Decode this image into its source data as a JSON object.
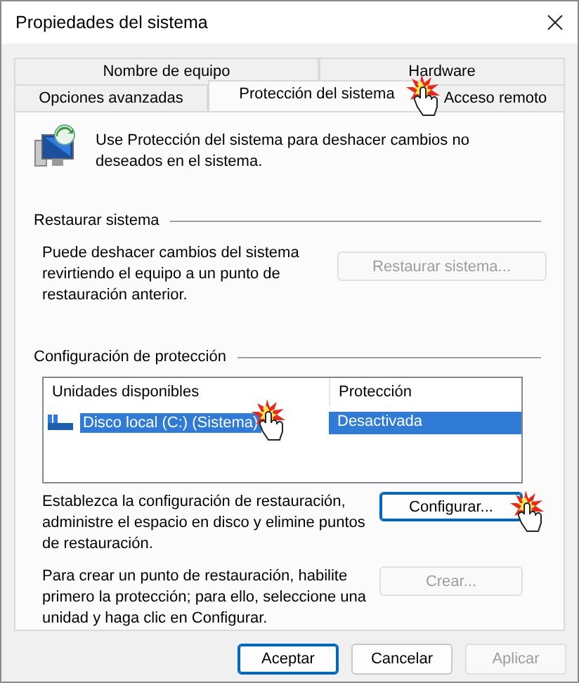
{
  "window": {
    "title": "Propiedades del sistema"
  },
  "tab_rows": [
    {
      "tabs": [
        {
          "label": "Nombre de equipo",
          "selected": false
        },
        {
          "label": "Hardware",
          "selected": false
        }
      ]
    },
    {
      "tabs": [
        {
          "label": "Opciones avanzadas",
          "selected": false
        },
        {
          "label": "Protección del sistema",
          "selected": true
        },
        {
          "label": "Acceso remoto",
          "selected": false
        }
      ]
    }
  ],
  "intro": "Use Protección del sistema para deshacer cambios no deseados en el sistema.",
  "restore_group": {
    "title": "Restaurar sistema",
    "description": "Puede deshacer cambios del sistema revirtiendo el equipo a un punto de restauración anterior.",
    "button": {
      "label": "Restaurar sistema...",
      "disabled": true
    }
  },
  "protection_group": {
    "title": "Configuración de protección",
    "table": {
      "columns": [
        "Unidades disponibles",
        "Protección"
      ],
      "rows": [
        {
          "drive": "Disco local (C:) (Sistema)",
          "protection": "Desactivada",
          "selected": true
        }
      ]
    },
    "configure": {
      "description": "Establezca la configuración de restauración, administre el espacio en disco y elimine puntos de restauración.",
      "button": {
        "label": "Configurar...",
        "disabled": false,
        "default": true
      }
    },
    "create": {
      "description": "Para crear un punto de restauración, habilite primero la protección; para ello, seleccione una unidad y haga clic en Configurar.",
      "button": {
        "label": "Crear...",
        "disabled": true
      }
    }
  },
  "buttons": [
    {
      "label": "Aceptar",
      "default": true,
      "disabled": false
    },
    {
      "label": "Cancelar",
      "default": false,
      "disabled": false
    },
    {
      "label": "Aplicar",
      "default": false,
      "disabled": true
    }
  ]
}
